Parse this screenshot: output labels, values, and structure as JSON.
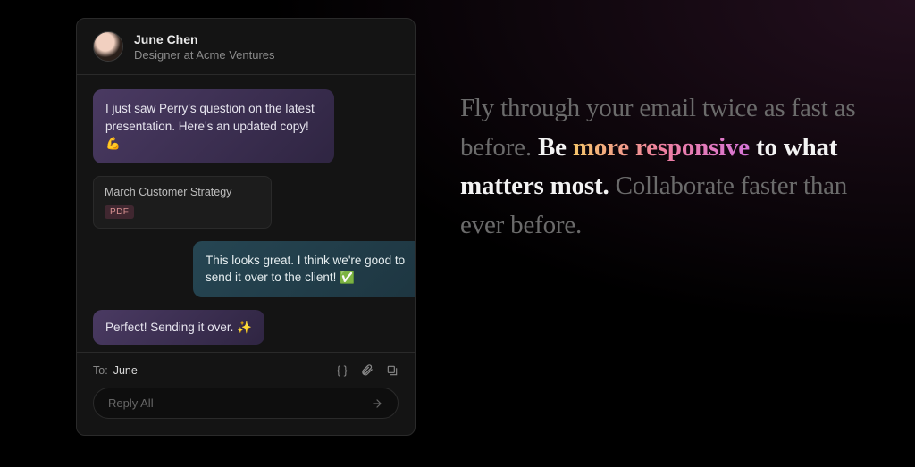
{
  "header": {
    "name": "June Chen",
    "subtitle": "Designer at Acme Ventures"
  },
  "messages": {
    "m1": "I just saw Perry's question on the latest presentation. Here's an updated copy! 💪",
    "m2": "This looks great. I think we're good to send it over to the client! ✅",
    "m3": "Perfect! Sending it over. ✨"
  },
  "attachment": {
    "title": "March Customer Strategy",
    "badge": "PDF"
  },
  "composer": {
    "to_label": "To:",
    "to_name": "June",
    "placeholder": "Reply All"
  },
  "marketing": {
    "line1": "Fly through your email twice as fast as before.",
    "be": "Be ",
    "grad": "more responsive",
    "rest2": " to what matters most.",
    "line3": "Collaborate faster than ever before."
  }
}
